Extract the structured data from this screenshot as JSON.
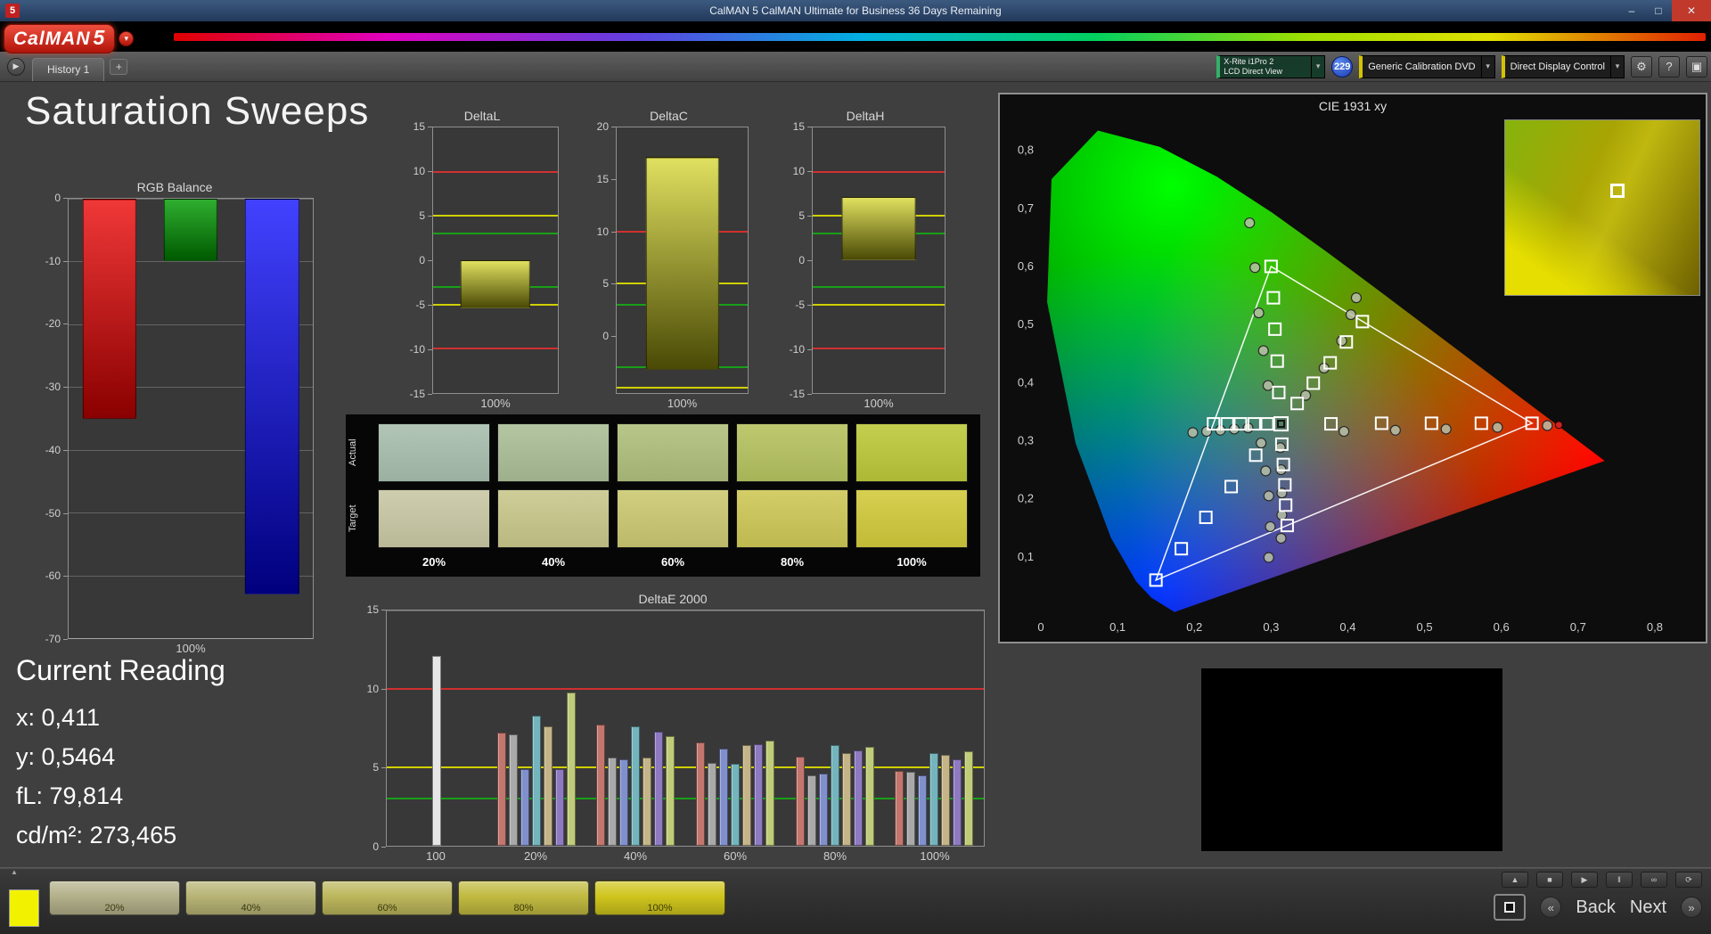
{
  "window": {
    "title": "CalMAN 5 CalMAN Ultimate for Business 36 Days Remaining",
    "app_icon_text": "5",
    "minimize_glyph": "–",
    "maximize_glyph": "□",
    "close_glyph": "✕"
  },
  "logo": {
    "brand": "CalMAN",
    "version": "5",
    "menu_caret": "▾"
  },
  "nav": {
    "run_glyph": "▶",
    "history_tab": "History 1",
    "add_tab": "+"
  },
  "toolbar": {
    "meter_line1": "X-Rite i1Pro 2",
    "meter_line2": "LCD Direct View",
    "meter_accent": "#35b06a",
    "badge_text": "229",
    "source_label": "Generic Calibration DVD",
    "source_accent": "#d4c400",
    "display_label": "Direct Display Control",
    "display_accent": "#d4c400",
    "caret_glyph": "▾",
    "settings_glyph": "⚙",
    "help_glyph": "?",
    "window_glyph": "▣"
  },
  "page": {
    "title": "Saturation Sweeps"
  },
  "current_reading": {
    "title": "Current Reading",
    "lines": [
      "x: 0,411",
      "y: 0,5464",
      "fL: 79,814",
      "cd/m²: 273,465"
    ]
  },
  "swatch_table": {
    "row_labels": [
      "Actual",
      "Target"
    ],
    "column_labels": [
      "20%",
      "40%",
      "60%",
      "80%",
      "100%"
    ],
    "actual_colors": [
      "#a9bfae",
      "#abbf97",
      "#b0c07c",
      "#b6c35f",
      "#bcc93a"
    ],
    "target_colors": [
      "#c9c9a5",
      "#cac88c",
      "#ccc972",
      "#cfc857",
      "#d2ca3c"
    ]
  },
  "footer": {
    "collapse_glyph": "▲",
    "current_swatch_color": "#f2f200",
    "patches": [
      {
        "label": "20%",
        "color": "#b3b18a"
      },
      {
        "label": "40%",
        "color": "#b7b475"
      },
      {
        "label": "60%",
        "color": "#bcb75c"
      },
      {
        "label": "80%",
        "color": "#c1ba41"
      },
      {
        "label": "100%",
        "color": "#cfc51d"
      }
    ],
    "transport": [
      {
        "name": "eject",
        "glyph": "▲"
      },
      {
        "name": "stop",
        "glyph": "■"
      },
      {
        "name": "play",
        "glyph": "▶"
      },
      {
        "name": "pause",
        "glyph": "‖"
      },
      {
        "name": "loop",
        "glyph": "∞"
      },
      {
        "name": "refresh",
        "glyph": "⟳"
      }
    ],
    "back_chevron": "«",
    "back_label": "Back",
    "next_label": "Next",
    "next_chevron": "»"
  },
  "chart_data": [
    {
      "id": "rgb_balance",
      "type": "bar",
      "title": "RGB Balance",
      "categories": [
        "Red",
        "Green",
        "Blue"
      ],
      "values": [
        -35,
        -10,
        -63
      ],
      "bar_colors": [
        [
          "#f03838",
          "#8a0000"
        ],
        [
          "#2fae2f",
          "#005a00"
        ],
        [
          "#4242ff",
          "#00007e"
        ]
      ],
      "ylim": [
        -70,
        0
      ],
      "yticks": [
        0,
        -10,
        -20,
        -30,
        -40,
        -50,
        -60,
        -70
      ],
      "grid": true,
      "xlabel": "100%"
    },
    {
      "id": "delta_l",
      "type": "bar",
      "title": "DeltaL",
      "values": [
        -5.4
      ],
      "bar_base": 0,
      "bar_colors": [
        [
          "#e0e060",
          "#4a4a06"
        ]
      ],
      "ylim": [
        -15,
        15
      ],
      "yticks": [
        15,
        10,
        5,
        0,
        -5,
        -10,
        -15
      ],
      "ref_lines": [
        {
          "y": 10,
          "color": "#d03030"
        },
        {
          "y": -10,
          "color": "#d03030"
        },
        {
          "y": 5,
          "color": "#d0d000"
        },
        {
          "y": -5,
          "color": "#d0d000"
        },
        {
          "y": 3,
          "color": "#18a018"
        },
        {
          "y": -3,
          "color": "#18a018"
        }
      ],
      "xlabel": "100%"
    },
    {
      "id": "delta_c",
      "type": "bar",
      "title": "DeltaC",
      "values": [
        17.2
      ],
      "bar_base": -3.3,
      "bar_colors": [
        [
          "#e0e060",
          "#4a4a06"
        ]
      ],
      "ylim": [
        -5.5,
        20
      ],
      "yticks": [
        20,
        15,
        10,
        5,
        0
      ],
      "ref_lines": [
        {
          "y": 10,
          "color": "#d03030"
        },
        {
          "y": 5,
          "color": "#d0d000"
        },
        {
          "y": -5,
          "color": "#d0d000"
        },
        {
          "y": 3,
          "color": "#18a018"
        },
        {
          "y": -3,
          "color": "#18a018"
        }
      ],
      "xlabel": "100%"
    },
    {
      "id": "delta_h",
      "type": "bar",
      "title": "DeltaH",
      "values": [
        7.1
      ],
      "bar_base": 0,
      "bar_colors": [
        [
          "#e0e060",
          "#4a4a06"
        ]
      ],
      "ylim": [
        -15,
        15
      ],
      "yticks": [
        15,
        10,
        5,
        0,
        -5,
        -10,
        -15
      ],
      "ref_lines": [
        {
          "y": 10,
          "color": "#d03030"
        },
        {
          "y": -10,
          "color": "#d03030"
        },
        {
          "y": 5,
          "color": "#d0d000"
        },
        {
          "y": -5,
          "color": "#d0d000"
        },
        {
          "y": 3,
          "color": "#18a018"
        },
        {
          "y": -3,
          "color": "#18a018"
        }
      ],
      "xlabel": "100%"
    },
    {
      "id": "delta_e",
      "type": "bar",
      "title": "DeltaE 2000",
      "ylim": [
        0,
        15
      ],
      "yticks": [
        0,
        5,
        10,
        15
      ],
      "grid": true,
      "ref_lines": [
        {
          "y": 10,
          "color": "#d03030"
        },
        {
          "y": 5,
          "color": "#d0d000"
        },
        {
          "y": 3,
          "color": "#18a018"
        }
      ],
      "palette": [
        "#c2766e",
        "#a9a9a9",
        "#8090cc",
        "#74b4bc",
        "#c4b488",
        "#8e7ac0",
        "#c0cc7a"
      ],
      "groups": [
        {
          "label": "100",
          "values": [
            12.1
          ],
          "colors": [
            "#e6e6e6"
          ]
        },
        {
          "label": "20%",
          "values": [
            7.2,
            7.1,
            4.9,
            8.3,
            7.6,
            4.9,
            9.8
          ]
        },
        {
          "label": "40%",
          "values": [
            7.7,
            5.6,
            5.5,
            7.6,
            5.6,
            7.3,
            7.0
          ]
        },
        {
          "label": "60%",
          "values": [
            6.6,
            5.3,
            6.2,
            5.2,
            6.4,
            6.5,
            6.7
          ]
        },
        {
          "label": "80%",
          "values": [
            5.7,
            4.5,
            4.6,
            6.4,
            5.9,
            6.1,
            6.3
          ]
        },
        {
          "label": "100%",
          "values": [
            4.8,
            4.7,
            4.5,
            5.9,
            5.8,
            5.5,
            6.0
          ]
        }
      ]
    },
    {
      "id": "cie_1931",
      "type": "scatter",
      "title": "CIE 1931 xy",
      "xlim": [
        0,
        0.85
      ],
      "ylim": [
        0,
        0.85
      ],
      "xtick_labels": [
        "0",
        "0,1",
        "0,2",
        "0,3",
        "0,4",
        "0,5",
        "0,6",
        "0,7",
        "0,8"
      ],
      "ytick_labels": [
        "0,1",
        "0,2",
        "0,3",
        "0,4",
        "0,5",
        "0,6",
        "0,7",
        "0,8"
      ],
      "gamut_triangle": [
        [
          0.64,
          0.33
        ],
        [
          0.3,
          0.6
        ],
        [
          0.15,
          0.06
        ]
      ],
      "highlight_target": [
        0.313,
        0.329
      ],
      "targets": [
        [
          0.378,
          0.329
        ],
        [
          0.444,
          0.33
        ],
        [
          0.509,
          0.33
        ],
        [
          0.574,
          0.33
        ],
        [
          0.64,
          0.33
        ],
        [
          0.31,
          0.383
        ],
        [
          0.308,
          0.437
        ],
        [
          0.305,
          0.492
        ],
        [
          0.303,
          0.546
        ],
        [
          0.3,
          0.6
        ],
        [
          0.28,
          0.275
        ],
        [
          0.248,
          0.221
        ],
        [
          0.215,
          0.168
        ],
        [
          0.183,
          0.114
        ],
        [
          0.15,
          0.06
        ],
        [
          0.295,
          0.329
        ],
        [
          0.278,
          0.329
        ],
        [
          0.26,
          0.329
        ],
        [
          0.243,
          0.329
        ],
        [
          0.225,
          0.329
        ],
        [
          0.314,
          0.294
        ],
        [
          0.316,
          0.259
        ],
        [
          0.318,
          0.224
        ],
        [
          0.319,
          0.189
        ],
        [
          0.321,
          0.154
        ],
        [
          0.334,
          0.364
        ],
        [
          0.355,
          0.399
        ],
        [
          0.377,
          0.434
        ],
        [
          0.398,
          0.47
        ],
        [
          0.419,
          0.505
        ]
      ],
      "measurements": [
        [
          0.395,
          0.316
        ],
        [
          0.462,
          0.318
        ],
        [
          0.528,
          0.32
        ],
        [
          0.595,
          0.323
        ],
        [
          0.66,
          0.326
        ],
        [
          0.296,
          0.395
        ],
        [
          0.29,
          0.455
        ],
        [
          0.284,
          0.52
        ],
        [
          0.279,
          0.598
        ],
        [
          0.272,
          0.675
        ],
        [
          0.287,
          0.296
        ],
        [
          0.293,
          0.248
        ],
        [
          0.297,
          0.205
        ],
        [
          0.299,
          0.152
        ],
        [
          0.297,
          0.099
        ],
        [
          0.27,
          0.322
        ],
        [
          0.252,
          0.32
        ],
        [
          0.234,
          0.318
        ],
        [
          0.216,
          0.316
        ],
        [
          0.198,
          0.314
        ],
        [
          0.312,
          0.288
        ],
        [
          0.313,
          0.25
        ],
        [
          0.314,
          0.21
        ],
        [
          0.314,
          0.172
        ],
        [
          0.313,
          0.132
        ],
        [
          0.345,
          0.378
        ],
        [
          0.369,
          0.425
        ],
        [
          0.392,
          0.472
        ],
        [
          0.404,
          0.517
        ],
        [
          0.411,
          0.546
        ]
      ],
      "extra_dots": [
        {
          "x": 0.675,
          "y": 0.327,
          "color": "#cc2222"
        }
      ]
    }
  ]
}
